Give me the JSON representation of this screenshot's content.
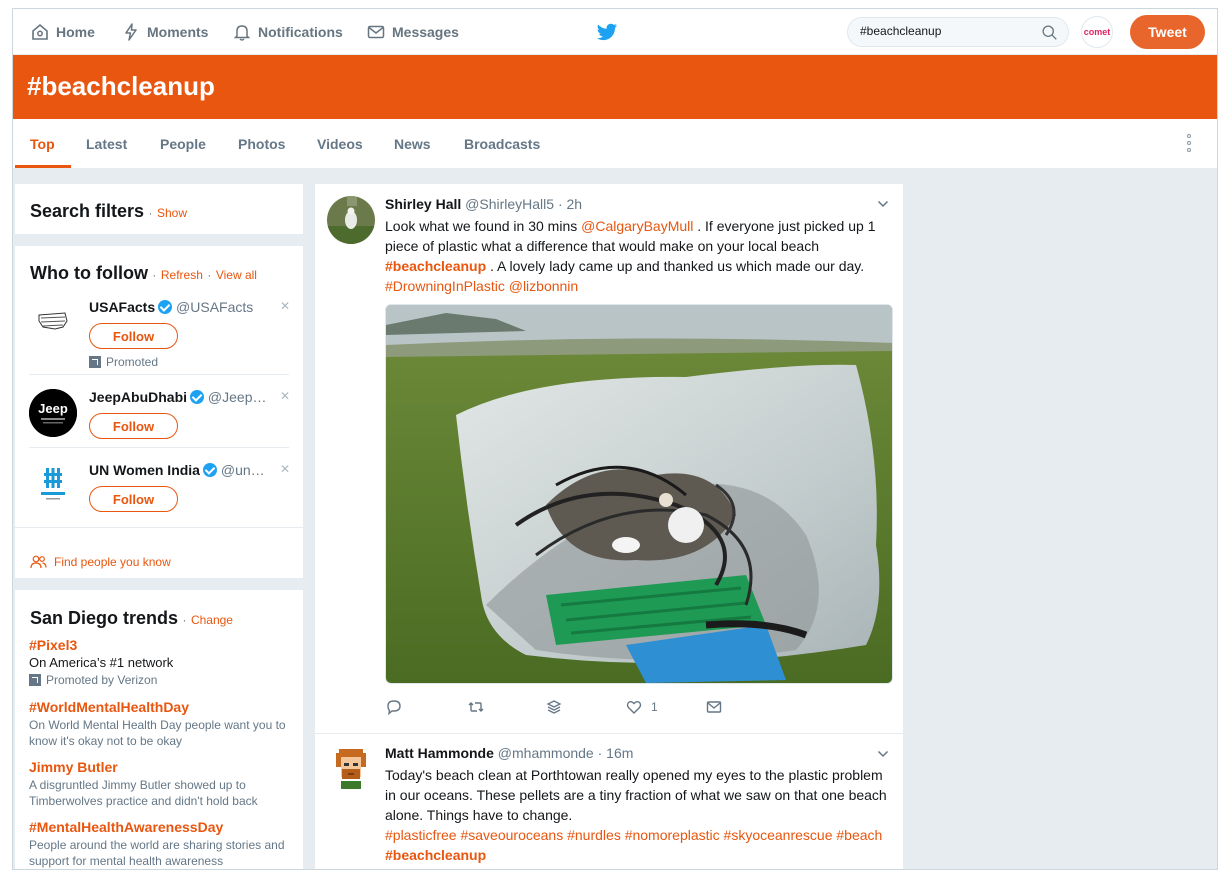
{
  "nav": {
    "home": "Home",
    "moments": "Moments",
    "notifications": "Notifications",
    "messages": "Messages",
    "search_value": "#beachcleanup",
    "avatar_text": "comet",
    "tweet_button": "Tweet"
  },
  "header": {
    "title": "#beachcleanup"
  },
  "tabs": [
    {
      "label": "Top"
    },
    {
      "label": "Latest"
    },
    {
      "label": "People"
    },
    {
      "label": "Photos"
    },
    {
      "label": "Videos"
    },
    {
      "label": "News"
    },
    {
      "label": "Broadcasts"
    }
  ],
  "filters": {
    "title": "Search filters",
    "link": "Show"
  },
  "who_to_follow": {
    "title": "Who to follow",
    "refresh": "Refresh",
    "view_all": "View all",
    "follow_label": "Follow",
    "promoted": "Promoted",
    "accounts": [
      {
        "name": "USAFacts",
        "handle": "@USAFacts",
        "avatar": "USAFACTS"
      },
      {
        "name": "JeepAbuDhabi",
        "handle": "@Jeep…",
        "avatar": "Jeep"
      },
      {
        "name": "UN Women India",
        "handle": "@un…",
        "avatar": "#UN WOMEN"
      }
    ],
    "find_people": "Find people you know"
  },
  "trends": {
    "title": "San Diego trends",
    "change": "Change",
    "items": [
      {
        "name": "#Pixel3",
        "desc": "On America’s #1 network",
        "promoted": "Promoted by Verizon"
      },
      {
        "name": "#WorldMentalHealthDay",
        "desc": "On World Mental Health Day people want you to know it's okay not to be okay"
      },
      {
        "name": "Jimmy Butler",
        "desc": "A disgruntled Jimmy Butler showed up to Timberwolves practice and didn't hold back"
      },
      {
        "name": "#MentalHealthAwarenessDay",
        "desc": "People around the world are sharing stories and support for mental health awareness"
      }
    ]
  },
  "tweets": [
    {
      "name": "Shirley Hall",
      "handle": "@ShirleyHall5",
      "time": "· 2h",
      "t1": "Look what we found in 30 mins ",
      "mention1": "@CalgaryBayMull",
      "t2": " . If everyone just picked up 1 piece of plastic what a difference that would make on your local beach ",
      "tag1": "#beachcleanup",
      "t3": " . A lovely lady came up and thanked us which made our day. ",
      "tag2": "#DrowningInPlastic",
      "mention2": "@lizbonnin",
      "likes": "1"
    },
    {
      "name": "Matt Hammonde",
      "handle": "@mhammonde",
      "time": "· 16m",
      "text": "Today's beach clean at Porthtowan really opened my eyes to the plastic problem in our oceans. These pellets are a tiny fraction of what we saw on that one beach alone. Things have to change.",
      "tags": "#plasticfree #saveouroceans #nurdles #nomoreplastic #skyoceanrescue #beach",
      "tag_bold": "#beachcleanup"
    }
  ],
  "colors": {
    "accent": "#e8560f",
    "twitter_blue": "#1da1f2",
    "page_bg": "#e6ecf0"
  }
}
